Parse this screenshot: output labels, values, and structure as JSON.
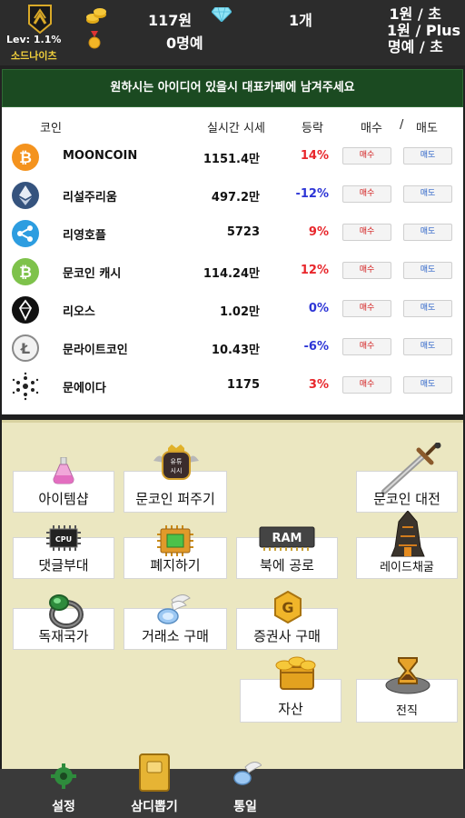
{
  "status": {
    "level": "Lev: 1.1%",
    "rank": "소드나이츠",
    "gold": "117원",
    "fame": "0명예",
    "gems": "1개",
    "rate_per_sec": "1원 / 초",
    "rate_plus": "1원 / Plus",
    "fame_rate": "명예 / 초"
  },
  "notice": "원하시는 아이디어 있을시 대표카페에 남겨주세요",
  "table": {
    "headers": {
      "coin": "코인",
      "price": "실시간 시세",
      "change": "등락",
      "buy": "매수",
      "sep": "/",
      "sell": "매도"
    },
    "buy_label": "매수",
    "sell_label": "매도",
    "rows": [
      {
        "icon": "bitcoin-icon",
        "name": "MOONCOIN",
        "price": "1151.4만",
        "change": "14%",
        "color": "#e8262b"
      },
      {
        "icon": "ethereum-icon",
        "name": "리설주리움",
        "price": "497.2만",
        "change": "-12%",
        "color": "#2d35d6"
      },
      {
        "icon": "ripple-icon",
        "name": "리영호플",
        "price": "5723",
        "change": "9%",
        "color": "#e8262b"
      },
      {
        "icon": "bitcoin-cash-icon",
        "name": "문코인 캐시",
        "price": "114.24만",
        "change": "12%",
        "color": "#e8262b"
      },
      {
        "icon": "eos-icon",
        "name": "리오스",
        "price": "1.02만",
        "change": "0%",
        "color": "#2d35d6"
      },
      {
        "icon": "litecoin-icon",
        "name": "문라이트코인",
        "price": "10.43만",
        "change": "-6%",
        "color": "#2d35d6"
      },
      {
        "icon": "cardano-icon",
        "name": "문에이다",
        "price": "1175",
        "change": "3%",
        "color": "#e8262b"
      }
    ]
  },
  "menu": {
    "item_shop": "아이템샵",
    "spread_rumor": "문코인 퍼주기",
    "rumor_badge": "유튜\n시시",
    "moon_battle": "문코인 대전",
    "comment_army": "댓글부대",
    "cpu_label": "CPU",
    "shutdown": "폐지하기",
    "ram_label": "RAM",
    "north_attack": "북에 공로",
    "raid_mining": "레이드채굴",
    "dictator": "독재국가",
    "exchange_buy": "거래소 구매",
    "securities_buy": "증권사 구매",
    "assets": "자산",
    "job_change": "전직"
  },
  "bottom": {
    "settings": "설정",
    "card_draw": "삼디뽑기",
    "unify": "통일"
  }
}
